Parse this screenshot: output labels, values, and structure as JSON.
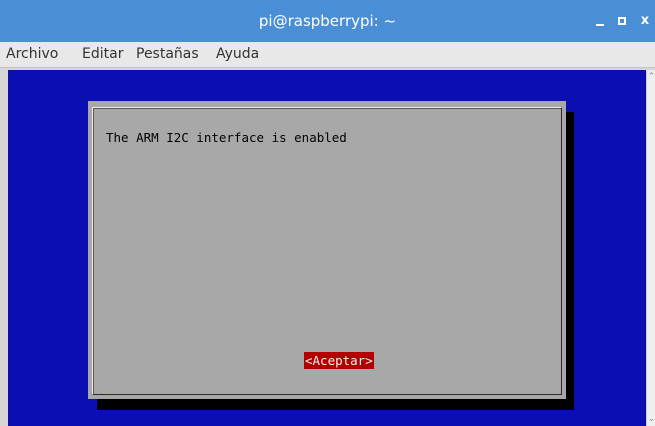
{
  "window": {
    "title": "pi@raspberrypi: ~",
    "controls": {
      "minimize_icon": "minimize-icon",
      "maximize_icon": "maximize-icon",
      "close_icon": "close-icon",
      "close_glyph": "x"
    },
    "titlebar_color": "#4a8ed6"
  },
  "menubar": {
    "items": [
      "Archivo",
      "Editar",
      "Pestañas",
      "Ayuda"
    ]
  },
  "terminal": {
    "background_color": "#0b0eb0"
  },
  "dialog": {
    "message": "The ARM I2C interface is enabled",
    "button_label": "<Aceptar>",
    "background_color": "#a8a8a8",
    "button_color": "#b00000"
  }
}
